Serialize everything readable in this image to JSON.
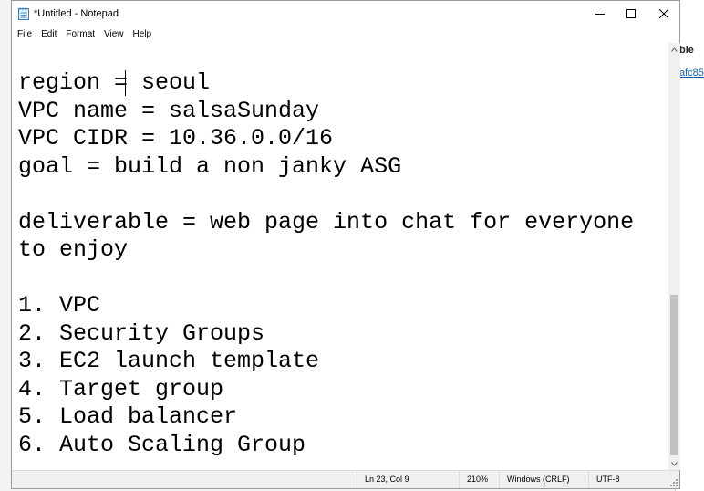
{
  "background_window": {
    "heading_fragment": "ble",
    "link_fragment": "afc85"
  },
  "window": {
    "title": "*Untitled - Notepad",
    "controls": {
      "minimize": "minimize-icon",
      "maximize": "maximize-icon",
      "close": "close-icon"
    }
  },
  "menu": {
    "file": "File",
    "edit": "Edit",
    "format": "Format",
    "view": "View",
    "help": "Help"
  },
  "editor": {
    "content": "region = seoul\nVPC name = salsaSunday\nVPC CIDR = 10.36.0.0/16\ngoal = build a non janky ASG\n\ndeliverable = web page into chat for everyone\nto enjoy\n\n1. VPC\n2. Security Groups\n3. EC2 launch template\n4. Target group\n5. Load balancer\n6. Auto Scaling Group"
  },
  "status": {
    "position": "Ln 23, Col 9",
    "zoom": "210%",
    "line_endings": "Windows (CRLF)",
    "encoding": "UTF-8"
  },
  "colors": {
    "scroll_thumb": "#c2c2c2",
    "statusbar": "#f0f0f0",
    "link": "#1a5fb4"
  }
}
